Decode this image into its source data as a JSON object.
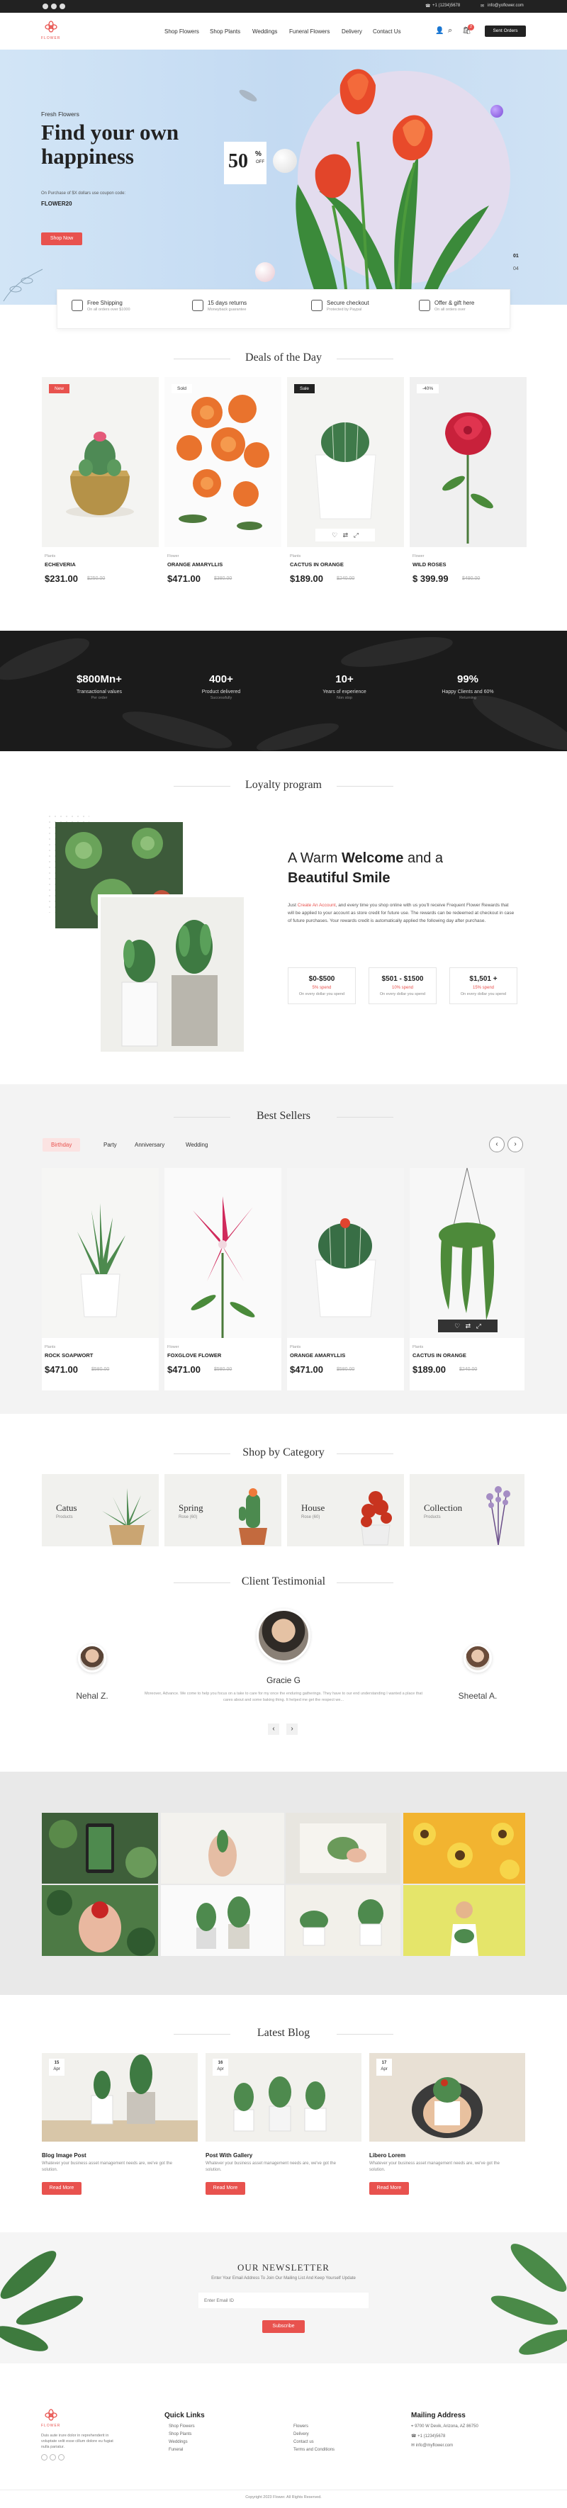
{
  "topbar": {
    "phone": "+1 (1234)5678",
    "email": "info@yoflower.com"
  },
  "brand": {
    "name": "FLOWER",
    "accent": "#e8524e"
  },
  "nav": [
    "Shop Flowers",
    "Shop Plants",
    "Weddings",
    "Funeral Flowers",
    "Delivery",
    "Contact Us"
  ],
  "header": {
    "cart_count": "2",
    "order_button": "Sent Orders"
  },
  "hero": {
    "eyebrow": "Fresh Flowers",
    "title_line1": "Find your own",
    "title_line2": "happiness",
    "desc": "On Purchase of $X dollars use coupon code:",
    "code": "FLOWER20",
    "button": "Shop Now",
    "discount_value": "50",
    "discount_unit": "%",
    "discount_off": "OFF",
    "slide_current": "01",
    "slide_total": "04"
  },
  "features": [
    {
      "title": "Free Shipping",
      "sub": "On all orders over $1000"
    },
    {
      "title": "15 days returns",
      "sub": "Moneyback guarantee"
    },
    {
      "title": "Secure checkout",
      "sub": "Protected by Paypal"
    },
    {
      "title": "Offer & gift here",
      "sub": "On all orders over"
    }
  ],
  "deals": {
    "title": "Deals of the Day",
    "items": [
      {
        "badge": "New",
        "category": "Plants",
        "name": "ECHEVERIA",
        "price": "$231.00",
        "old": "$250.00"
      },
      {
        "badge": "Sold",
        "category": "Flower",
        "name": "ORANGE AMARYLLIS",
        "price": "$471.00",
        "old": "$380.00"
      },
      {
        "badge": "Sale",
        "category": "Plants",
        "name": "CACTUS IN ORANGE",
        "price": "$189.00",
        "old": "$240.00"
      },
      {
        "badge": "-40%",
        "category": "Flower",
        "name": "WILD ROSES",
        "price": "$ 399.99",
        "old": "$490.00"
      }
    ]
  },
  "stats": [
    {
      "value": "$800Mn+",
      "label": "Transactional values",
      "sub": "Per order"
    },
    {
      "value": "400+",
      "label": "Product delivered",
      "sub": "Successfully"
    },
    {
      "value": "10+",
      "label": "Years of experience",
      "sub": "Non stop"
    },
    {
      "value": "99%",
      "label": "Happy Clients and 60%",
      "sub": "Returning"
    }
  ],
  "loyalty": {
    "title": "Loyalty program",
    "heading_pre": "A Warm",
    "heading_bold": "Welcome",
    "heading_post": "and a",
    "heading_line2": "Beautiful Smile",
    "body_pre": "Just",
    "body_link": "Create An Account",
    "body_post": ", and every time you shop online with us you'll receive Frequent Flower Rewards that will be applied to your account as store credit for future use. The rewards can be redeemed at checkout in case of future purchases. Your rewards credit is automatically applied the following day after purchase.",
    "tiers": [
      {
        "range": "$0-$500",
        "reward": "5% spend",
        "note": "On every dollar you spend"
      },
      {
        "range": "$501 - $1500",
        "reward": "10% spend",
        "note": "On every dollar you spend"
      },
      {
        "range": "$1,501 +",
        "reward": "15% spend",
        "note": "On every dollar you spend"
      }
    ]
  },
  "bestsellers": {
    "title": "Best Sellers",
    "tabs": [
      "Birthday",
      "Party",
      "Anniversary",
      "Wedding"
    ],
    "active_tab": "Birthday",
    "items": [
      {
        "category": "Plants",
        "name": "ROCK SOAPWORT",
        "price": "$471.00",
        "old": "$580.00"
      },
      {
        "category": "Flower",
        "name": "FOXGLOVE FLOWER",
        "price": "$471.00",
        "old": "$580.00"
      },
      {
        "category": "Plants",
        "name": "ORANGE AMARYLLIS",
        "price": "$471.00",
        "old": "$580.00"
      },
      {
        "category": "Plants",
        "name": "CACTUS IN ORANGE",
        "price": "$189.00",
        "old": "$240.00"
      }
    ]
  },
  "categories": {
    "title": "Shop by Category",
    "items": [
      {
        "name": "Catus",
        "count": "Products"
      },
      {
        "name": "Spring",
        "count": "Rose (60)"
      },
      {
        "name": "House",
        "count": "Rose (60)"
      },
      {
        "name": "Collection",
        "count": "Products"
      }
    ]
  },
  "testimonial": {
    "title": "Client Testimonial",
    "main_name": "Gracie G",
    "quote": "Moreover, Advance. We come to help you focus on a take to care for my once the enduring gatherings. They have to our end understanding I wanted a place that cares about and some baking thing. It helped me get the respect we...",
    "left_name": "Nehal Z.",
    "right_name": "Sheetal A."
  },
  "blog": {
    "title": "Latest Blog",
    "posts": [
      {
        "day": "15",
        "month": "Apr",
        "title": "Blog Image Post",
        "desc": "Whatever your business asset management needs are, we've got the solution.",
        "button": "Read More"
      },
      {
        "day": "16",
        "month": "Apr",
        "title": "Post With Gallery",
        "desc": "Whatever your business asset management needs are, we've got the solution.",
        "button": "Read More"
      },
      {
        "day": "17",
        "month": "Apr",
        "title": "Libero Lorem",
        "desc": "Whatever your business asset management needs are, we've got the solution.",
        "button": "Read More"
      }
    ]
  },
  "newsletter": {
    "title": "OUR NEWSLETTER",
    "sub": "Enter Your Email Address To Join Our Mailing List And Keep Yourself Update",
    "placeholder": "Enter Email ID",
    "button": "Subscribe"
  },
  "footer": {
    "about": "Duis aute irure dolor in reprehenderit in voluptate velit esse cillum dolore eu fugiat nulla pariatur.",
    "quick_links_title": "Quick Links",
    "links_col1": [
      "Shop Flowers",
      "Shop Plants",
      "Weddings",
      "Funeral"
    ],
    "links_col2": [
      "Flowers",
      "Delivery",
      "Contact us",
      "Terms and Conditions"
    ],
    "mailing_title": "Mailing Address",
    "address": "9700 W Devik, Arizona, AZ 86750",
    "phone": "+1 (1234)5678",
    "email": "info@myflower.com",
    "copyright": "Copyright 2023 Flower. All Rights Reserved."
  }
}
